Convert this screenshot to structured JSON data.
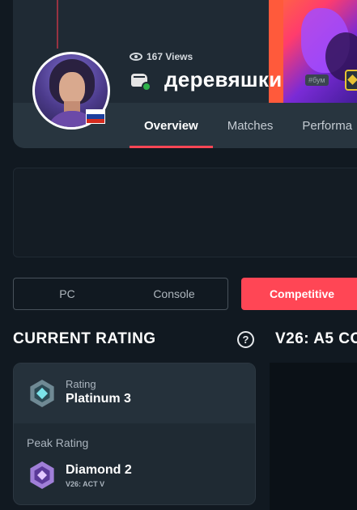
{
  "profile": {
    "views": "167 Views",
    "player_name": "деревяшки",
    "tag": "#бум",
    "country_flag_colors": [
      "#ffffff",
      "#1c3f9e",
      "#d52b1e"
    ]
  },
  "tabs": [
    {
      "label": "Overview",
      "active": true
    },
    {
      "label": "Matches",
      "active": false
    },
    {
      "label": "Performa",
      "active": false
    }
  ],
  "platform": {
    "options": [
      "PC",
      "Console"
    ],
    "competitive_label": "Competitive"
  },
  "current_rating": {
    "section_title": "CURRENT RATING",
    "help": "?",
    "rating_label": "Rating",
    "rating_value": "Platinum 3",
    "peak_label": "Peak Rating",
    "peak_value": "Diamond 2",
    "peak_act": "V26: ACT V"
  },
  "second_section": {
    "title": "V26: A5 CO"
  },
  "colors": {
    "accent": "#ff4655",
    "background": "#111921",
    "card": "#1f2a33"
  },
  "icons": [
    "eye-icon",
    "fist-rank-icon",
    "verified-check-icon",
    "help-icon",
    "platinum-rank-icon",
    "diamond-rank-icon",
    "gold-badge-icon"
  ]
}
